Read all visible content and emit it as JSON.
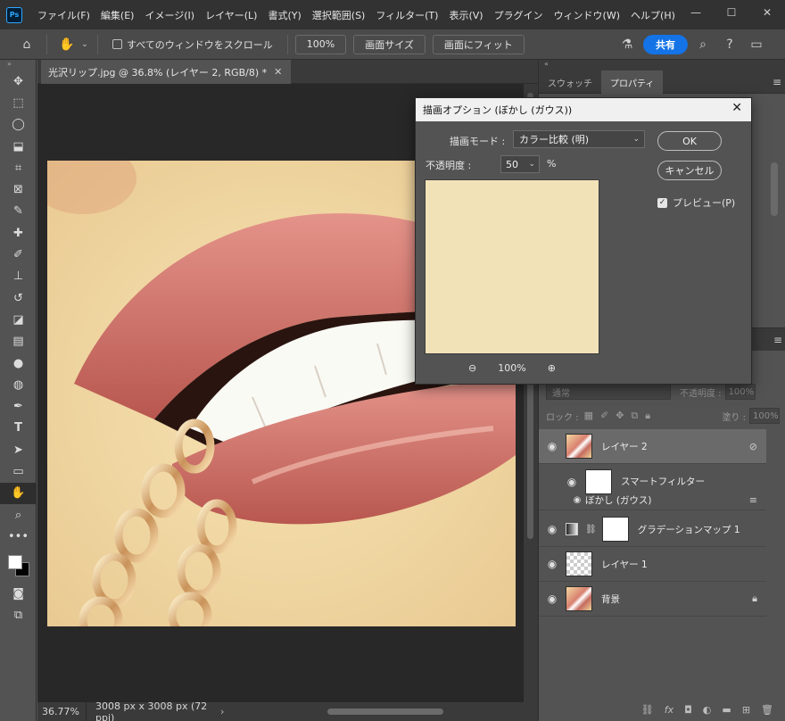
{
  "app": {
    "logo_text": "Ps",
    "menu": [
      "ファイル(F)",
      "編集(E)",
      "イメージ(I)",
      "レイヤー(L)",
      "書式(Y)",
      "選択範囲(S)",
      "フィルター(T)",
      "表示(V)",
      "プラグイン",
      "ウィンドウ(W)",
      "ヘルプ(H)"
    ]
  },
  "options_bar": {
    "scroll_all_label": "すべてのウィンドウをスクロール",
    "zoom_100_label": "100%",
    "fit_screen_label": "画面サイズ",
    "fill_screen_label": "画面にフィット",
    "share_label": "共有"
  },
  "document": {
    "tab_title": "光沢リップ.jpg @ 36.8% (レイヤー 2, RGB/8) *",
    "status_zoom": "36.77%",
    "status_info": "3008 px x 3008 px (72 ppi)"
  },
  "right_panel": {
    "tabs": [
      "スウォッチ",
      "プロパティ"
    ],
    "active_tab": 1,
    "blend_mode": "通常",
    "opacity_label": "不透明度 :",
    "opacity_value": "100%",
    "lock_label": "ロック :",
    "fill_label": "塗り :",
    "fill_value": "100%",
    "layers": [
      {
        "name": "レイヤー 2",
        "thumb": "lips",
        "selected": true
      },
      {
        "name": "スマートフィルター",
        "thumb": "white",
        "indent": true
      },
      {
        "name": "ぼかし (ガウス)",
        "indent": true,
        "filter": true
      },
      {
        "name": "グラデーションマップ 1",
        "thumb": "white",
        "adjustment": true
      },
      {
        "name": "レイヤー 1",
        "thumb": "checker"
      },
      {
        "name": "背景",
        "thumb": "lips",
        "locked": true
      }
    ]
  },
  "dialog": {
    "title": "描画オプション (ぼかし (ガウス))",
    "mode_label": "描画モード :",
    "mode_value": "カラー比較 (明)",
    "opacity_label": "不透明度 :",
    "opacity_value": "50",
    "opacity_unit": "%",
    "ok_label": "OK",
    "cancel_label": "キャンセル",
    "preview_label": "プレビュー(P)",
    "preview_checked": true,
    "zoom_value": "100%"
  },
  "icons": {
    "close": "close-icon",
    "home": "home-icon",
    "hand": "hand-icon",
    "search": "search-icon",
    "help": "help-icon"
  }
}
